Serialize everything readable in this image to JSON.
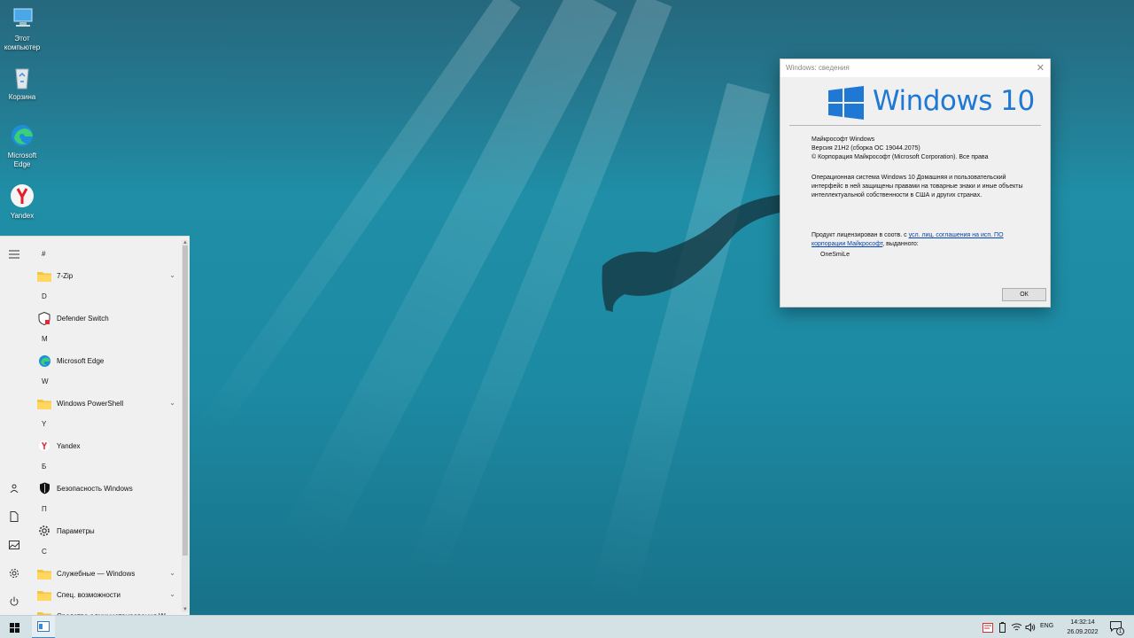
{
  "desktop": {
    "icons": [
      {
        "label": "Этот компьютер",
        "icon": "computer-icon"
      },
      {
        "label": "Корзина",
        "icon": "recycle-bin-icon"
      },
      {
        "label": "Microsoft Edge",
        "icon": "edge-icon"
      },
      {
        "label": "Yandex",
        "icon": "yandex-icon"
      }
    ]
  },
  "start_menu": {
    "sections": [
      {
        "letter": "#",
        "items": [
          {
            "label": "7-Zip",
            "icon": "folder-icon",
            "expandable": true
          }
        ]
      },
      {
        "letter": "D",
        "items": [
          {
            "label": "Defender Switch",
            "icon": "shield-icon",
            "expandable": false
          }
        ]
      },
      {
        "letter": "M",
        "items": [
          {
            "label": "Microsoft Edge",
            "icon": "edge-icon",
            "expandable": false
          }
        ]
      },
      {
        "letter": "W",
        "items": [
          {
            "label": "Windows PowerShell",
            "icon": "folder-icon",
            "expandable": true
          }
        ]
      },
      {
        "letter": "Y",
        "items": [
          {
            "label": "Yandex",
            "icon": "yandex-icon",
            "expandable": false
          }
        ]
      },
      {
        "letter": "Б",
        "items": [
          {
            "label": "Безопасность Windows",
            "icon": "security-shield-icon",
            "expandable": false
          }
        ]
      },
      {
        "letter": "П",
        "items": [
          {
            "label": "Параметры",
            "icon": "gear-icon",
            "expandable": false
          }
        ]
      },
      {
        "letter": "С",
        "items": [
          {
            "label": "Служебные — Windows",
            "icon": "folder-icon",
            "expandable": true
          },
          {
            "label": "Спец. возможности",
            "icon": "folder-icon",
            "expandable": true
          },
          {
            "label": "Средства администрирования W...",
            "icon": "folder-icon",
            "expandable": true
          }
        ]
      }
    ],
    "rail": [
      "hamburger-menu-icon",
      "user-icon",
      "documents-icon",
      "pictures-icon",
      "settings-icon",
      "power-icon"
    ]
  },
  "winver": {
    "title": "Windows: сведения",
    "wordmark": "Windows 10",
    "product": "Майкрософт Windows",
    "version": "Версия 21H2 (сборка ОС 19044.2075)",
    "copyright": "© Корпорация Майкрософт (Microsoft Corporation). Все права",
    "description": "Операционная система Windows 10 Домашняя и пользовательский интерфейс в ней защищены правами на товарные знаки и иные объекты интеллектуальной собственности в США и других странах.",
    "license_prefix": "Продукт лицензирован в соотв. с ",
    "license_link": "усл. лиц. соглашения на исп. ПО корпорации Майкрософт",
    "license_suffix": ", выданного:",
    "licensee": "OneSmiLe",
    "ok_label": "ОК",
    "accent": "#1e78d4"
  },
  "taskbar": {
    "language": "ENG",
    "time": "14:32:14",
    "date": "26.09.2022",
    "notification_count": "1"
  }
}
